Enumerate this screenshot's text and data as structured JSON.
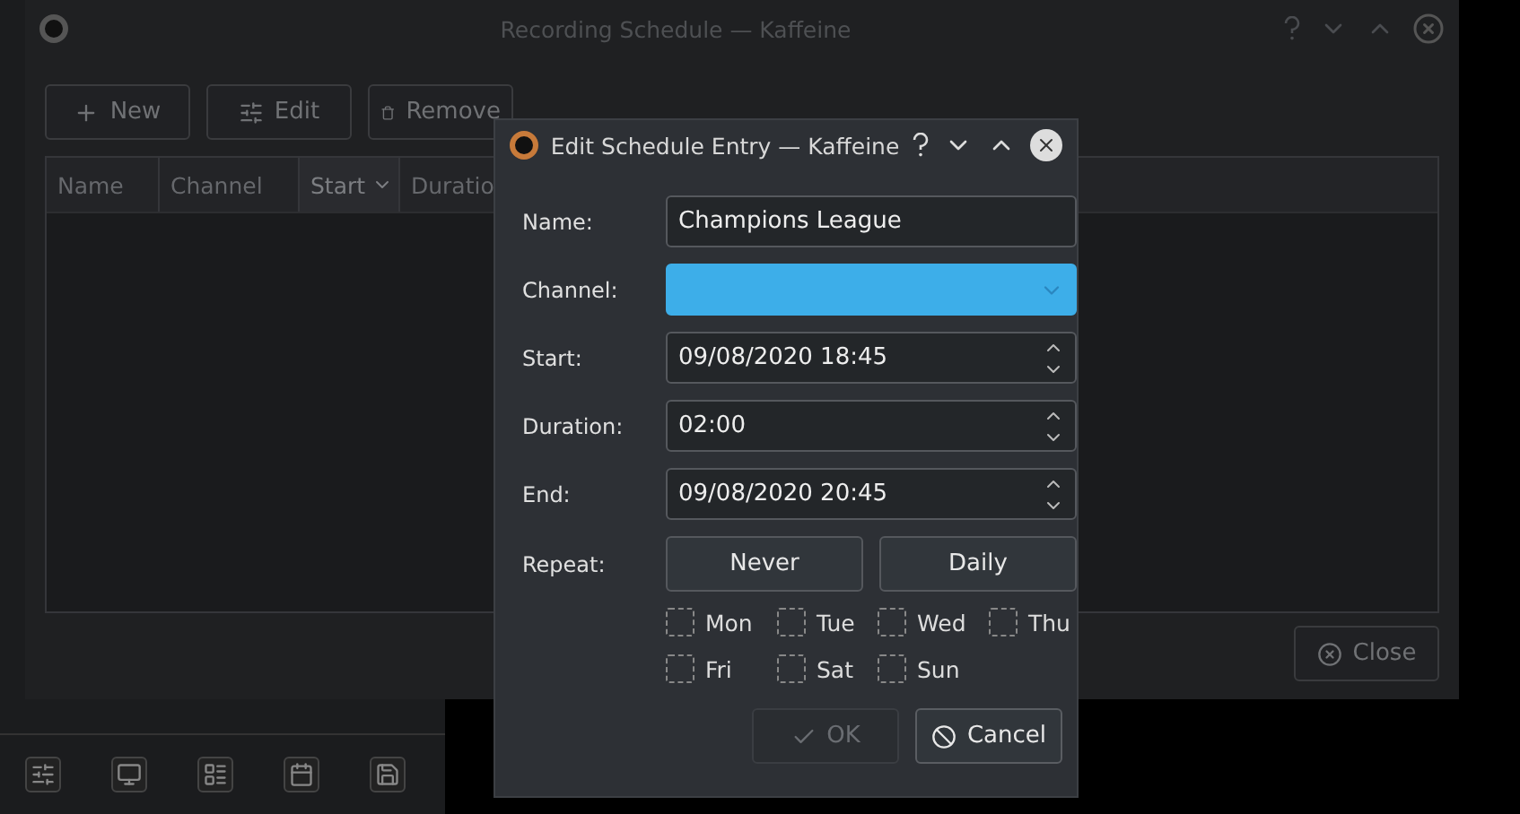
{
  "main_window": {
    "title": "Recording Schedule — Kaffeine",
    "toolbar": [
      {
        "kind": "new",
        "label": "New"
      },
      {
        "kind": "edit",
        "label": "Edit"
      },
      {
        "kind": "remove",
        "label": "Remove"
      }
    ],
    "table": {
      "columns": [
        {
          "label": "Name",
          "sorted": false
        },
        {
          "label": "Channel",
          "sorted": false
        },
        {
          "label": "Start",
          "sorted": true
        },
        {
          "label": "Duratio",
          "sorted": false
        }
      ]
    },
    "close_button": "Close"
  },
  "dialog": {
    "title": "Edit Schedule Entry — Kaffeine",
    "fields": [
      {
        "kind": "text",
        "label": "Name:",
        "value": "Champions League"
      },
      {
        "kind": "combo",
        "label": "Channel:"
      },
      {
        "kind": "spin",
        "label": "Start:",
        "value": "09/08/2020 18:45"
      },
      {
        "kind": "spin",
        "label": "Duration:",
        "value": "02:00"
      },
      {
        "kind": "spin",
        "label": "End:",
        "value": "09/08/2020 20:45"
      }
    ],
    "repeat_label": "Repeat:",
    "repeat_buttons": [
      {
        "label": "Never",
        "selected": false
      },
      {
        "label": "Daily",
        "selected": false
      }
    ],
    "days": [
      {
        "label": "Mon",
        "checked": false
      },
      {
        "label": "Tue",
        "checked": false
      },
      {
        "label": "Wed",
        "checked": false
      },
      {
        "label": "Thu",
        "checked": false
      },
      {
        "label": "Fri",
        "checked": false
      },
      {
        "label": "Sat",
        "checked": false
      },
      {
        "label": "Sun",
        "checked": false
      }
    ],
    "buttons": [
      {
        "kind": "ok",
        "label": "OK",
        "disabled": true
      },
      {
        "kind": "cancel",
        "label": "Cancel",
        "disabled": false
      }
    ]
  },
  "back_toolbar": [
    {
      "kind": "sliders"
    },
    {
      "kind": "monitor"
    },
    {
      "kind": "list"
    },
    {
      "kind": "calendar"
    },
    {
      "kind": "save"
    }
  ]
}
